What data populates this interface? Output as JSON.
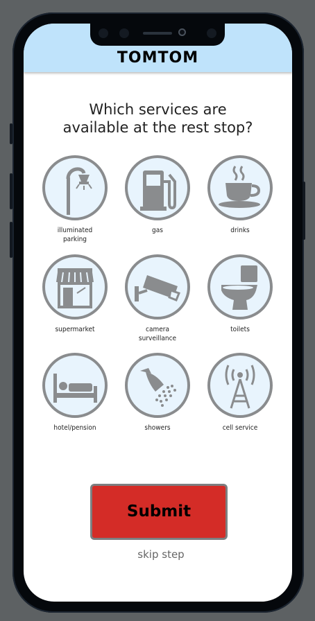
{
  "header": {
    "brand": "TOMTOM"
  },
  "question": {
    "line1": "Which services are",
    "line2": "available at the rest stop?"
  },
  "services": [
    {
      "id": "illuminated-parking",
      "icon": "street-lamp-icon",
      "line1": "illuminated",
      "line2": "parking"
    },
    {
      "id": "gas",
      "icon": "gas-pump-icon",
      "line1": "gas",
      "line2": ""
    },
    {
      "id": "drinks",
      "icon": "coffee-cup-icon",
      "line1": "drinks",
      "line2": ""
    },
    {
      "id": "supermarket",
      "icon": "store-icon",
      "line1": "supermarket",
      "line2": ""
    },
    {
      "id": "camera-surveillance",
      "icon": "security-camera-icon",
      "line1": "camera",
      "line2": "surveillance"
    },
    {
      "id": "toilets",
      "icon": "toilet-icon",
      "line1": "toilets",
      "line2": ""
    },
    {
      "id": "hotel-pension",
      "icon": "bed-icon",
      "line1": "hotel/pension",
      "line2": ""
    },
    {
      "id": "showers",
      "icon": "shower-icon",
      "line1": "showers",
      "line2": ""
    },
    {
      "id": "cell-service",
      "icon": "cell-tower-icon",
      "line1": "cell service",
      "line2": ""
    }
  ],
  "actions": {
    "submit_label": "Submit",
    "skip_label": "skip step"
  },
  "colors": {
    "header_bg": "#bfe3fb",
    "submit_bg": "#d42c27",
    "icon_gray": "#8a8c8e",
    "icon_bg": "#e8f4fd"
  }
}
